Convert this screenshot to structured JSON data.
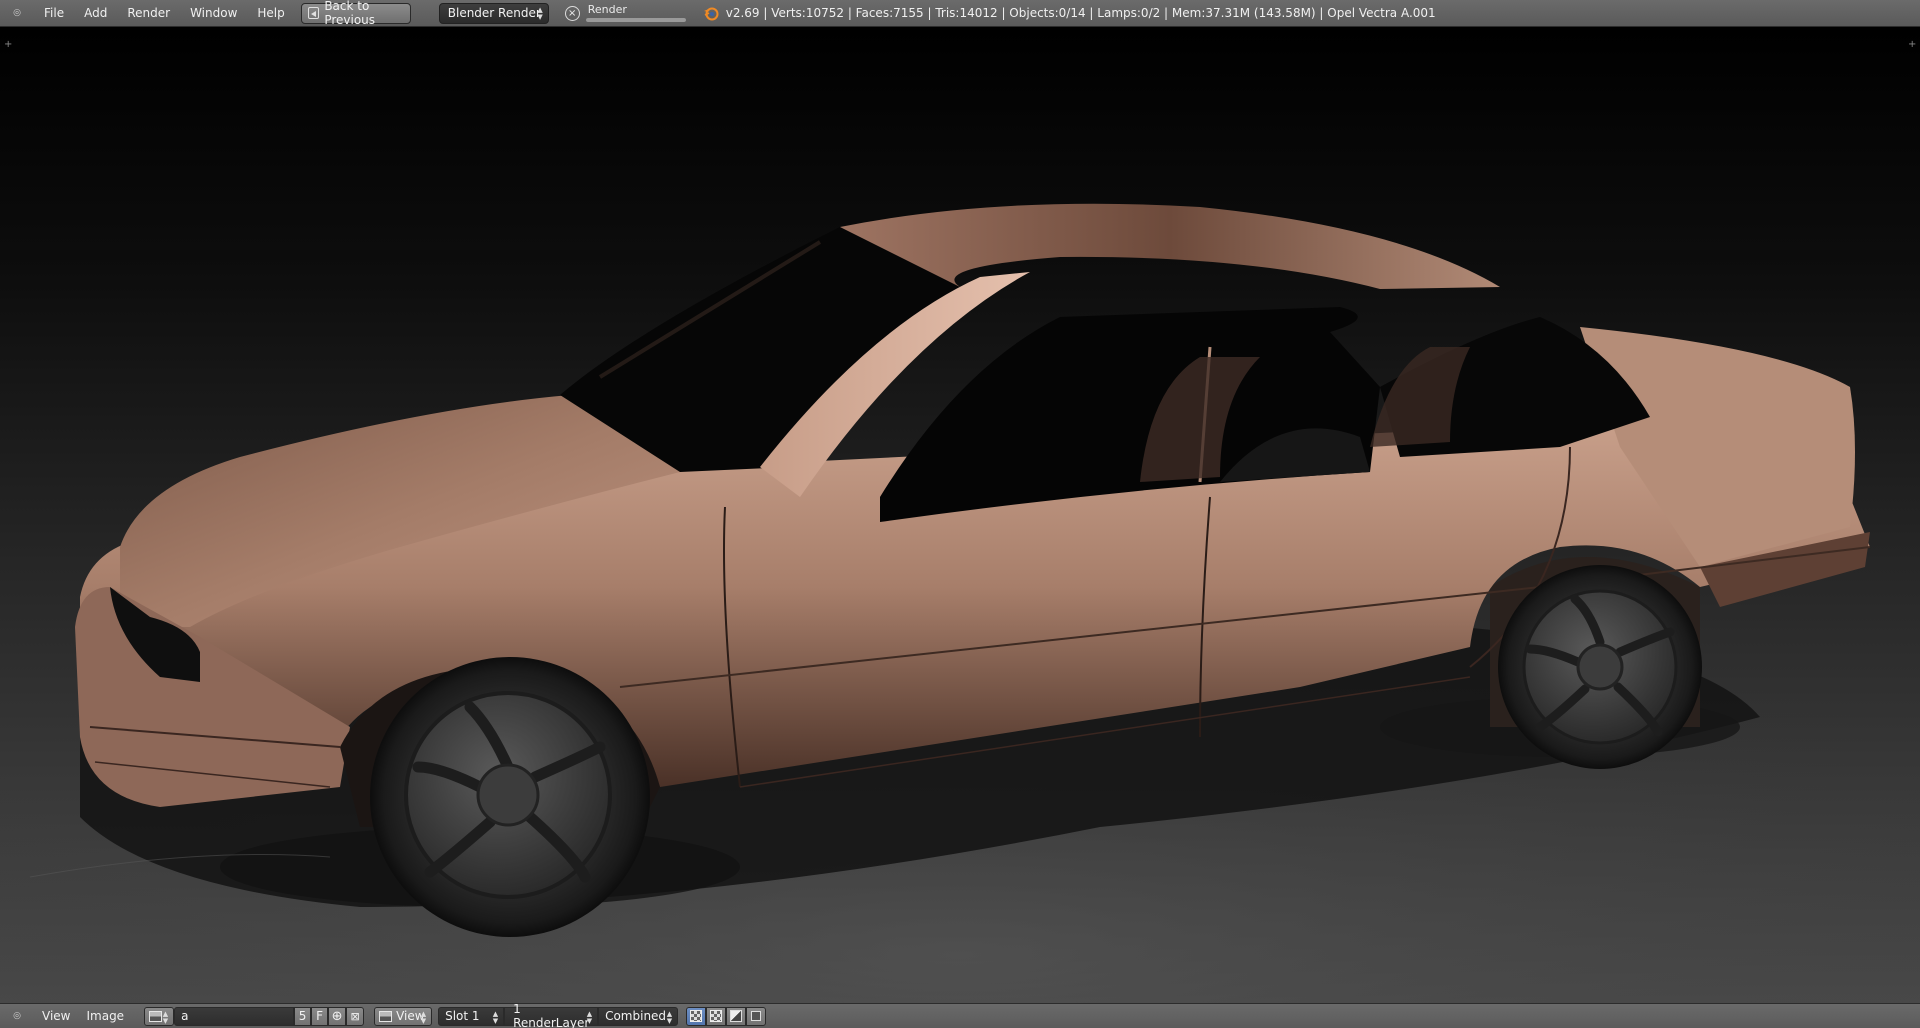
{
  "top_bar": {
    "menus": [
      "File",
      "Add",
      "Render",
      "Window",
      "Help"
    ],
    "back_button_label": "Back to Previous",
    "render_engine": "Blender Render",
    "render_job_label": "Render",
    "render_progress": 1.0,
    "stats": "v2.69 | Verts:10752 | Faces:7155 | Tris:14012 | Objects:0/14 | Lamps:0/2 | Mem:37.31M (143.58M) | Opel Vectra A.001"
  },
  "viewport": {
    "content": "rendered-car-image",
    "body_color": "#b08672",
    "background_top": "#000000",
    "background_bottom": "#4a4a4a"
  },
  "bottom_bar": {
    "menus": [
      "View",
      "Image"
    ],
    "image_name": "a",
    "users_count": "5",
    "fake_user_label": "F",
    "view_label": "View",
    "slot": "Slot 1",
    "render_layer": "1 RenderLayer",
    "render_pass": "Combined"
  },
  "icons": {
    "area_toggle": "area-toggle-icon",
    "back": "back-icon",
    "cancel": "cancel-icon",
    "logo": "blender-logo-icon",
    "image_browse": "image-icon",
    "new": "plus-icon",
    "unlink": "close-icon",
    "alpha": "checker-icon",
    "z": "z-buffer-icon",
    "color": "color-icon",
    "full": "square-icon"
  }
}
